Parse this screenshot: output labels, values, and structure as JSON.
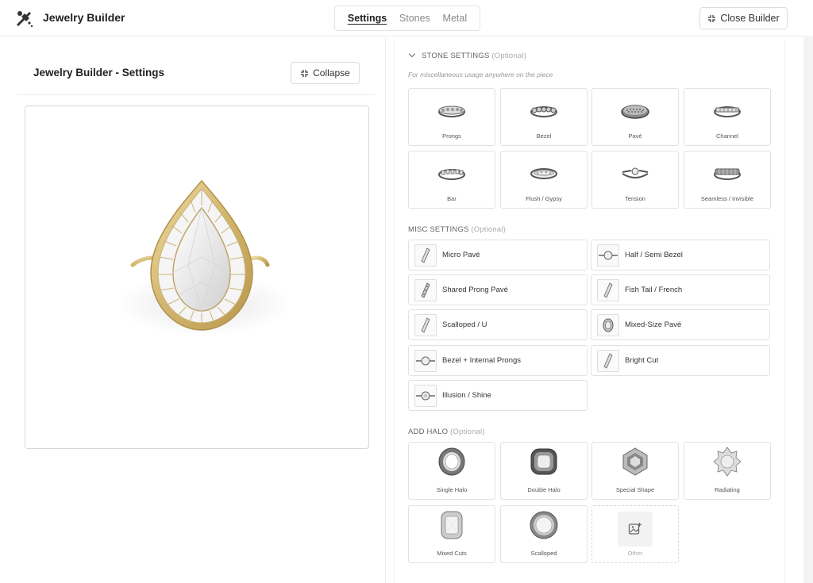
{
  "header": {
    "app_title": "Jewelry Builder",
    "tabs": [
      {
        "label": "Settings",
        "active": true
      },
      {
        "label": "Stones",
        "active": false
      },
      {
        "label": "Metal",
        "active": false
      }
    ],
    "close_label": "Close Builder"
  },
  "left": {
    "title": "Jewelry Builder - Settings",
    "collapse_label": "Collapse"
  },
  "stone_settings": {
    "title": "STONE SETTINGS",
    "optional": "(Optional)",
    "note": "For miscellaneous usage anywhere on the piece",
    "items": [
      "Prongs",
      "Bezel",
      "Pavé",
      "Channel",
      "Bar",
      "Flush / Gypsy",
      "Tension",
      "Seamless / Invisible"
    ]
  },
  "misc_settings": {
    "title": "MISC SETTINGS",
    "optional": "(Optional)",
    "items": [
      "Micro Pavé",
      "Half / Semi Bezel",
      "Shared Prong Pavé",
      "Fish Tail / French",
      "Scalloped / U",
      "Mixed-Size Pavé",
      "Bezel + Internal Prongs",
      "Bright Cut",
      "Illusion / Shine"
    ]
  },
  "add_halo": {
    "title": "ADD HALO",
    "optional": "(Optional)",
    "items": [
      "Single Halo",
      "Double Halo",
      "Special Shape",
      "Radiating",
      "Mixed Cuts",
      "Scalloped",
      "Other"
    ]
  },
  "colors": {
    "gold": "#d9bf7a",
    "border": "#e2e2e2",
    "text": "#222222"
  }
}
